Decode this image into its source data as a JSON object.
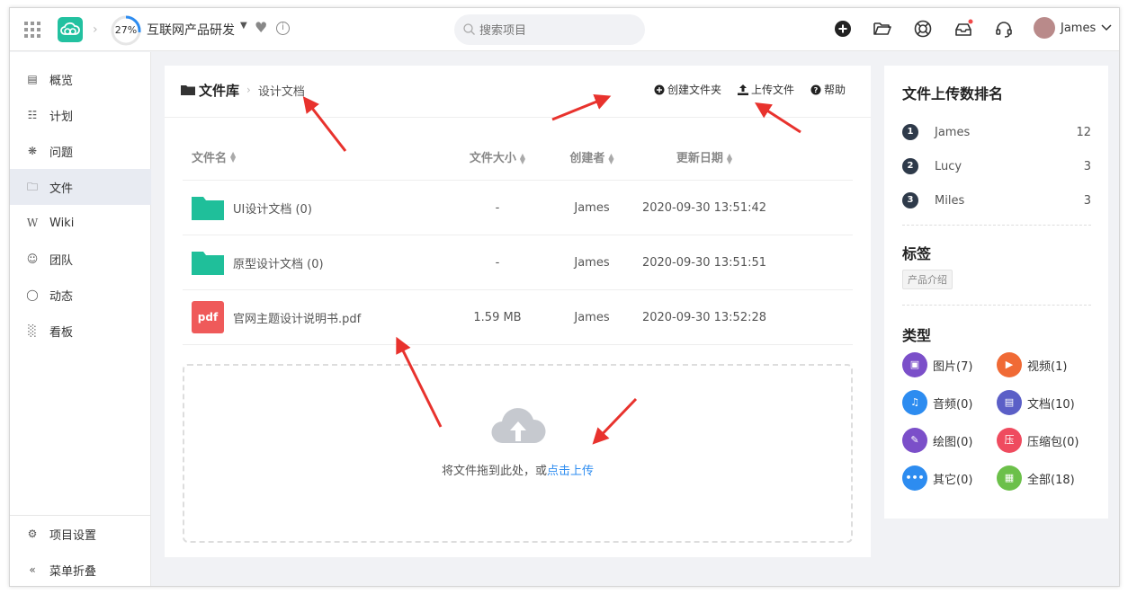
{
  "topbar": {
    "progress": "27%",
    "progress_fraction": 0.27,
    "project_name": "互联网产品研发",
    "search_placeholder": "搜索项目",
    "user_name": "James"
  },
  "sidebar": {
    "items": [
      {
        "label": "概览",
        "icon": "overview-icon"
      },
      {
        "label": "计划",
        "icon": "plan-icon"
      },
      {
        "label": "问题",
        "icon": "bug-icon"
      },
      {
        "label": "文件",
        "icon": "folder-icon"
      },
      {
        "label": "Wiki",
        "icon": "wiki-icon"
      },
      {
        "label": "团队",
        "icon": "team-icon"
      },
      {
        "label": "动态",
        "icon": "activity-icon"
      },
      {
        "label": "看板",
        "icon": "board-icon"
      }
    ],
    "active_index": 3,
    "settings_label": "项目设置",
    "collapse_label": "菜单折叠"
  },
  "main": {
    "breadcrumb_root": "文件库",
    "breadcrumb_current": "设计文档",
    "actions": {
      "create_folder": "创建文件夹",
      "upload_file": "上传文件",
      "help": "帮助"
    },
    "columns": [
      "文件名",
      "文件大小",
      "创建者",
      "更新日期"
    ],
    "files": [
      {
        "name": "UI设计文档 (0)",
        "size": "-",
        "creator": "James",
        "date": "2020-09-30 13:51:42",
        "type": "folder"
      },
      {
        "name": "原型设计文档 (0)",
        "size": "-",
        "creator": "James",
        "date": "2020-09-30 13:51:51",
        "type": "folder"
      },
      {
        "name": "官网主题设计说明书.pdf",
        "size": "1.59 MB",
        "creator": "James",
        "date": "2020-09-30 13:52:28",
        "type": "pdf"
      }
    ],
    "pdf_badge": "pdf",
    "drop_text": "将文件拖到此处，或",
    "drop_link": "点击上传"
  },
  "panel": {
    "ranking_title": "文件上传数排名",
    "ranking": [
      {
        "num": "1",
        "name": "James",
        "count": "12"
      },
      {
        "num": "2",
        "name": "Lucy",
        "count": "3"
      },
      {
        "num": "3",
        "name": "Miles",
        "count": "3"
      }
    ],
    "tags_title": "标签",
    "tags": [
      "产品介绍"
    ],
    "types_title": "类型",
    "types": [
      {
        "label": "图片(7)",
        "color": "#7b4fc9",
        "icon": "image-icon"
      },
      {
        "label": "视频(1)",
        "color": "#f06a35",
        "icon": "video-icon"
      },
      {
        "label": "音频(0)",
        "color": "#2d8cf0",
        "icon": "audio-icon"
      },
      {
        "label": "文档(10)",
        "color": "#5b5fc7",
        "icon": "document-icon"
      },
      {
        "label": "绘图(0)",
        "color": "#7b4fc9",
        "icon": "drawing-icon"
      },
      {
        "label": "压缩包(0)",
        "color": "#ef4b5f",
        "icon": "archive-icon",
        "glyph": "压"
      },
      {
        "label": "其它(0)",
        "color": "#2d8cf0",
        "icon": "other-icon"
      },
      {
        "label": "全部(18)",
        "color": "#6cc04a",
        "icon": "all-icon"
      }
    ]
  },
  "colors": {
    "accent": "#22c1a0",
    "link": "#2d8cf0",
    "annotation": "#e8322d"
  }
}
